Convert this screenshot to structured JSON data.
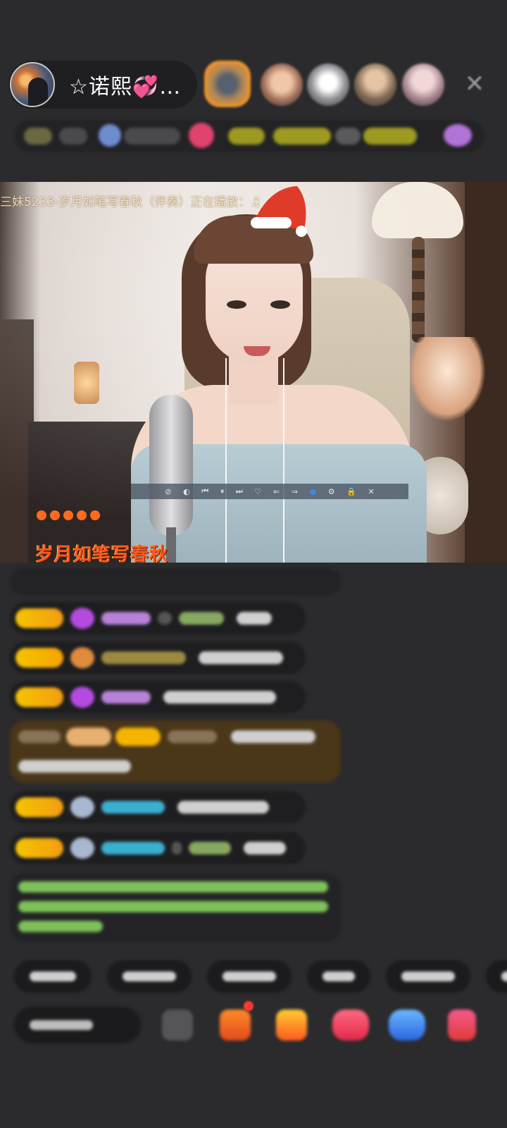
{
  "header": {
    "host_name": "☆诺熙💞…",
    "close_glyph": "✕"
  },
  "video": {
    "ticker": "三妹5233-岁月如笔写春秋（伴奏）正在播放：♫",
    "song_title": "岁月如笔写春秋",
    "controls": [
      "⊘",
      "◐",
      "⏮",
      "⏸",
      "⏭",
      "♡",
      "⇐",
      "⇒",
      "●",
      "⚙",
      "🔒",
      "✕"
    ]
  },
  "colors": {
    "background": "#2b2b2d",
    "accent_orange": "#ff5a1f",
    "badge_gold": "#f5c400"
  },
  "icons": [
    "santa-hat-icon",
    "gem-icon",
    "gift-icon",
    "red-envelope-icon",
    "game-icon"
  ]
}
